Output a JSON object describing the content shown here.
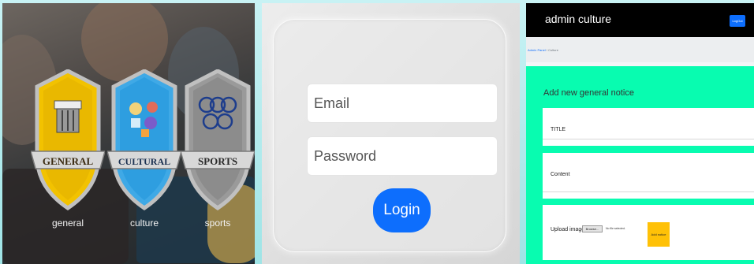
{
  "panels": {
    "categories": {
      "items": [
        {
          "badge_text": "GENERAL",
          "label": "general",
          "icon": "book-icon",
          "color": "#f2c200"
        },
        {
          "badge_text": "CULTURAL",
          "label": "culture",
          "icon": "culture-collage-icon",
          "color": "#3fa9e6"
        },
        {
          "badge_text": "SPORTS",
          "label": "sports",
          "icon": "sports-icon",
          "color": "#9a9a9a"
        }
      ]
    },
    "login": {
      "email_placeholder": "Email",
      "password_placeholder": "Password",
      "login_label": "Login",
      "button_color": "#0d6efd"
    },
    "admin": {
      "brand": "admin culture",
      "logout_label": "LogOut",
      "breadcrumb": {
        "parent": "Admin Panel",
        "separator": "/",
        "current": "Culture"
      },
      "form_title": "Add new general notice",
      "title_label": "TITLE",
      "content_label": "Content",
      "upload_label": "Upload image",
      "browse_label": "Browse...",
      "no_file_text": "No file selected.",
      "add_button_label": "Add notice",
      "accent_color": "#08fcb0",
      "add_button_color": "#ffc107"
    }
  }
}
